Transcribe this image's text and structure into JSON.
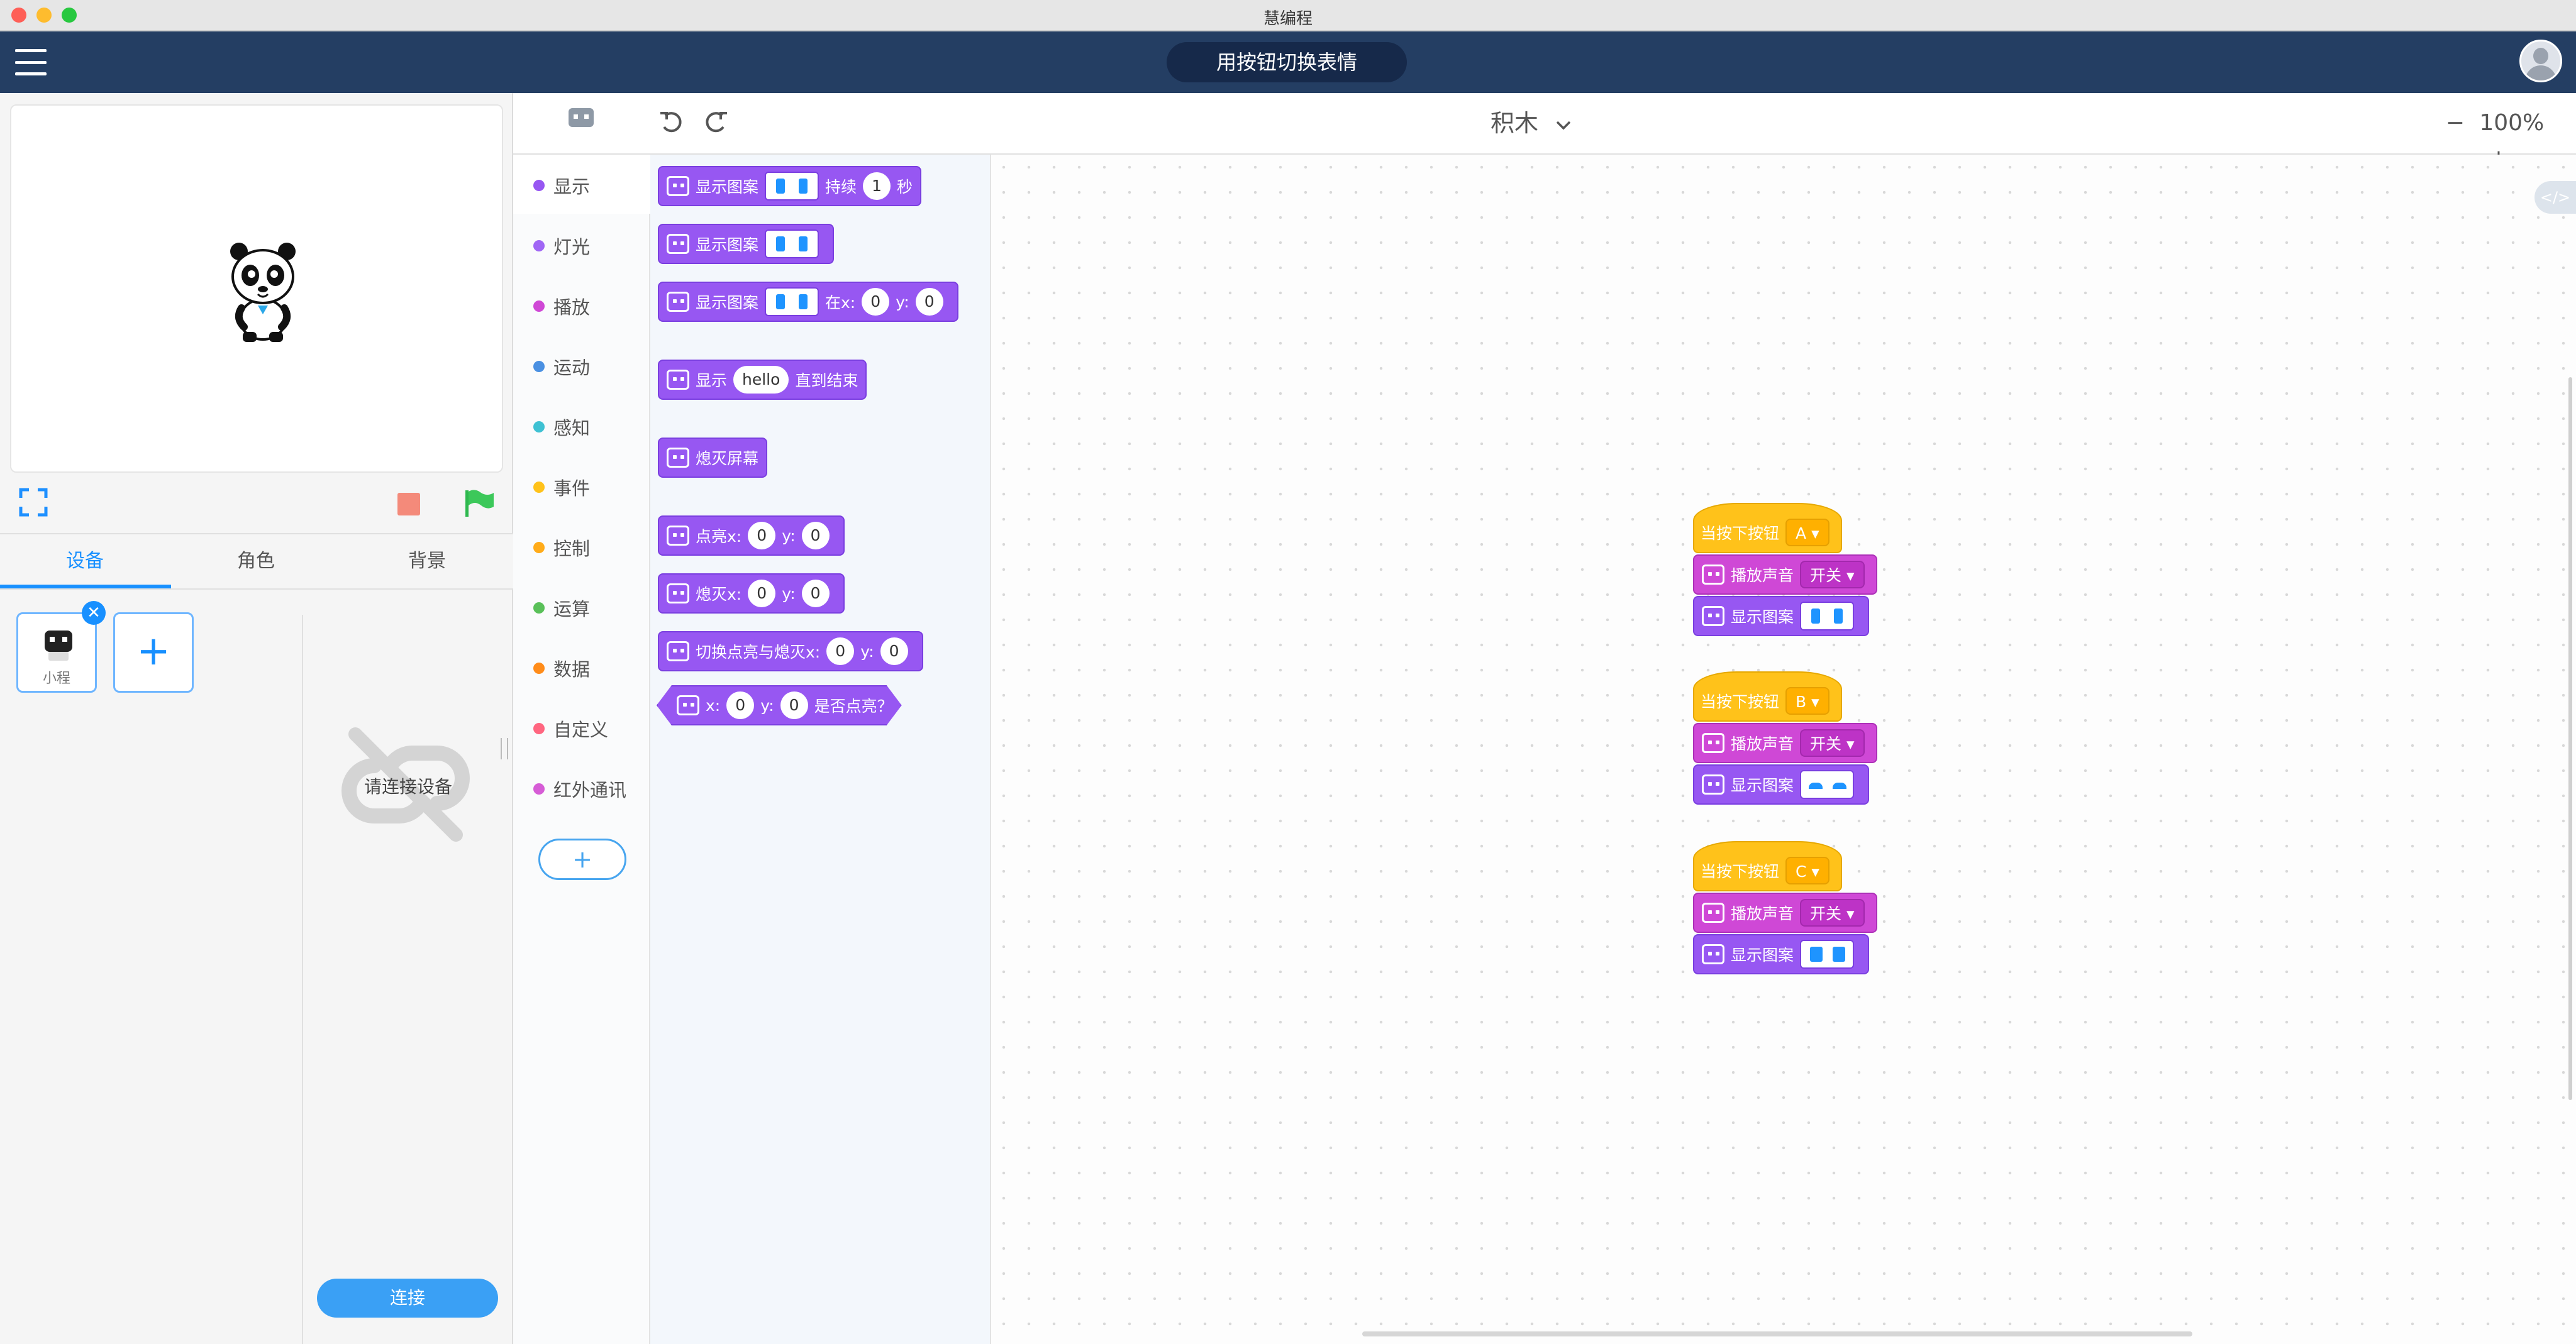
{
  "window": {
    "title": "慧编程"
  },
  "header": {
    "project_name": "用按钮切换表情"
  },
  "stage_controls": {
    "fullscreen": "fullscreen-icon",
    "stop": "stop-icon",
    "start": "green-flag-icon"
  },
  "tabs": [
    {
      "label": "设备"
    },
    {
      "label": "角色"
    },
    {
      "label": "背景"
    }
  ],
  "device": {
    "name": "小程",
    "add_symbol": "+",
    "close_symbol": "✕",
    "connect_hint": "请连接设备",
    "connect_button": "连接"
  },
  "toolbar": {
    "mode": "积木",
    "zoom_out": "−",
    "zoom": "100%",
    "zoom_in": "+"
  },
  "categories": [
    {
      "label": "显示",
      "color": "#9757f2"
    },
    {
      "label": "灯光",
      "color": "#a066f5"
    },
    {
      "label": "播放",
      "color": "#cf48d6"
    },
    {
      "label": "运动",
      "color": "#4a90e2"
    },
    {
      "label": "感知",
      "color": "#3ec1d3"
    },
    {
      "label": "事件",
      "color": "#ffc21a"
    },
    {
      "label": "控制",
      "color": "#ffab19"
    },
    {
      "label": "运算",
      "color": "#59c059"
    },
    {
      "label": "数据",
      "color": "#ff8c1a"
    },
    {
      "label": "自定义",
      "color": "#ff6680"
    },
    {
      "label": "红外通讯",
      "color": "#d65cd6"
    }
  ],
  "category_add": "+",
  "palette": {
    "b1": {
      "t1": "显示图案",
      "t2": "持续",
      "v1": "1",
      "t3": "秒"
    },
    "b2": {
      "t1": "显示图案"
    },
    "b3": {
      "t1": "显示图案",
      "t2": "在x:",
      "v1": "0",
      "t3": "y:",
      "v2": "0"
    },
    "b4": {
      "t1": "显示",
      "v1": "hello",
      "t2": "直到结束"
    },
    "b5": {
      "t1": "熄灭屏幕"
    },
    "b6": {
      "t1": "点亮x:",
      "v1": "0",
      "t2": "y:",
      "v2": "0"
    },
    "b7": {
      "t1": "熄灭x:",
      "v1": "0",
      "t2": "y:",
      "v2": "0"
    },
    "b8": {
      "t1": "切换点亮与熄灭x:",
      "v1": "0",
      "t2": "y:",
      "v2": "0"
    },
    "b9": {
      "t1": "x:",
      "v1": "0",
      "t2": "y:",
      "v2": "0",
      "t3": "是否点亮？"
    }
  },
  "scripts": [
    {
      "hat": "当按下按钮",
      "button": "A",
      "sound": "播放声音",
      "sound_opt": "开关",
      "show": "显示图案"
    },
    {
      "hat": "当按下按钮",
      "button": "B",
      "sound": "播放声音",
      "sound_opt": "开关",
      "show": "显示图案"
    },
    {
      "hat": "当按下按钮",
      "button": "C",
      "sound": "播放声音",
      "sound_opt": "开关",
      "show": "显示图案"
    }
  ],
  "code_toggle": "</>"
}
